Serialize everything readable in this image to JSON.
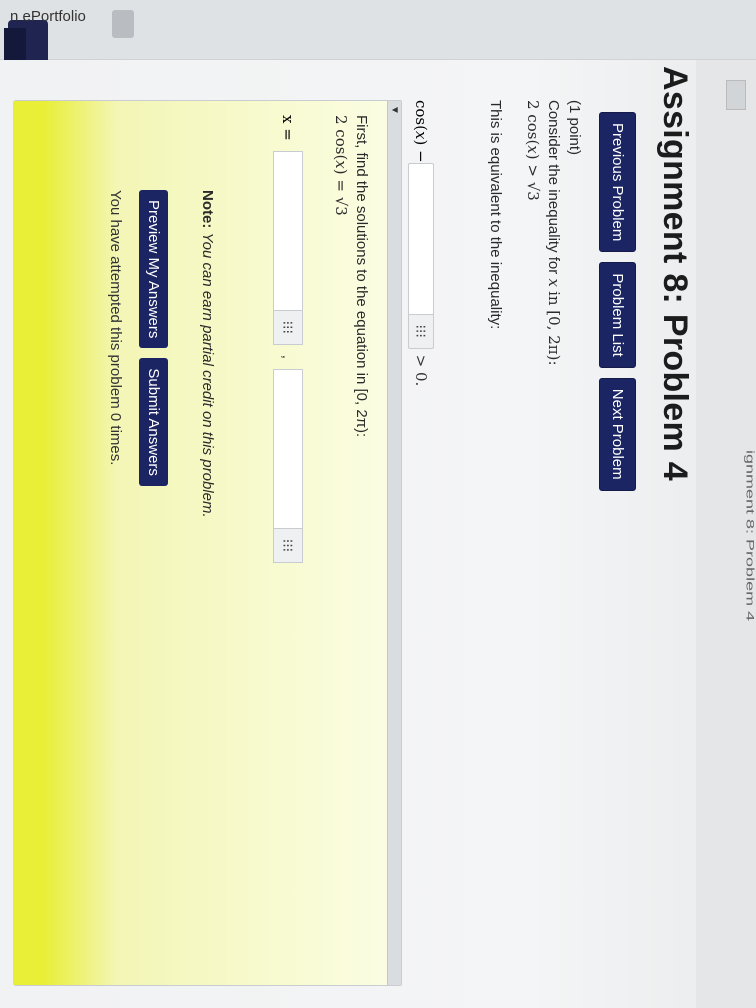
{
  "sidebar": {
    "portfolio_label": "n ePortfolio"
  },
  "header": {
    "cut_title": "ignment 8: Problem 4"
  },
  "page": {
    "title": "Assignment 8: Problem 4"
  },
  "nav": {
    "previous": "Previous Problem",
    "list": "Problem List",
    "next": "Next Problem"
  },
  "problem": {
    "points": "(1 point)",
    "intro": "Consider the inequality for",
    "var": "x",
    "interval_text": "in [0, 2π):",
    "inequality_lhs": "2 cos(",
    "inequality_rhs": ") > √3",
    "equiv_text": "This is equivalent to the inequality:",
    "cos_prefix": "cos(",
    "cos_suffix": ") −",
    "gt_zero": "> 0.",
    "grid_icon": "⁝⁝⁝"
  },
  "step": {
    "caret": "▼",
    "instruction": "First, find the solutions to the equation in [0, 2π):",
    "equation_lhs": "2 cos(",
    "equation_rhs": ") = √3",
    "x_label": "x =",
    "comma": ","
  },
  "note": {
    "label": "Note:",
    "text": "You can earn partial credit on this problem."
  },
  "answers": {
    "preview": "Preview My Answers",
    "submit": "Submit Answers",
    "attempts": "You have attempted this problem 0 times."
  }
}
